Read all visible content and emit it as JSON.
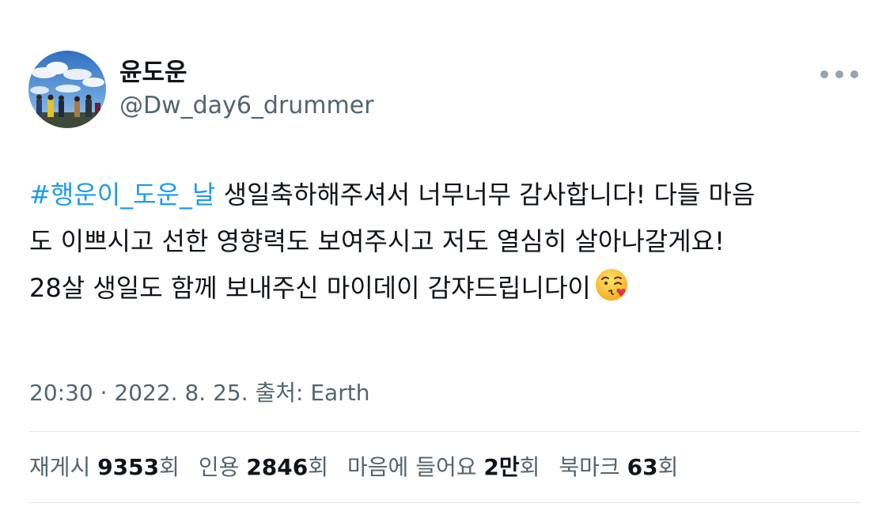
{
  "user": {
    "display_name": "윤도운",
    "handle": "@Dw_day6_drummer"
  },
  "tweet": {
    "hashtag": "#행운이_도운_날",
    "line1_rest": " 생일축하해주셔서 너무너무 감사합니다! 다들 마음",
    "line2": "도 이쁘시고 선한 영향력도 보여주시고 저도 열심히 살아나갈게요!",
    "line3": "28살 생일도 함께 보내주신 마이데이 감쟈드립니다이",
    "emoji": "face-blowing-a-kiss"
  },
  "meta": {
    "time": "20:30",
    "separator": " · ",
    "date": "2022. 8. 25.",
    "source": " 출처: Earth"
  },
  "stats": {
    "retweets_label": "재게시 ",
    "retweets_value": "9353",
    "retweets_unit": "회",
    "quotes_label": "인용 ",
    "quotes_value": "2846",
    "quotes_unit": "회",
    "likes_label": "마음에 들어요 ",
    "likes_value": "2만",
    "likes_unit": "회",
    "bookmarks_label": "북마크 ",
    "bookmarks_value": "63",
    "bookmarks_unit": "회"
  },
  "colors": {
    "link": "#1d9bf0",
    "text": "#0f1419",
    "secondary": "#536471"
  }
}
